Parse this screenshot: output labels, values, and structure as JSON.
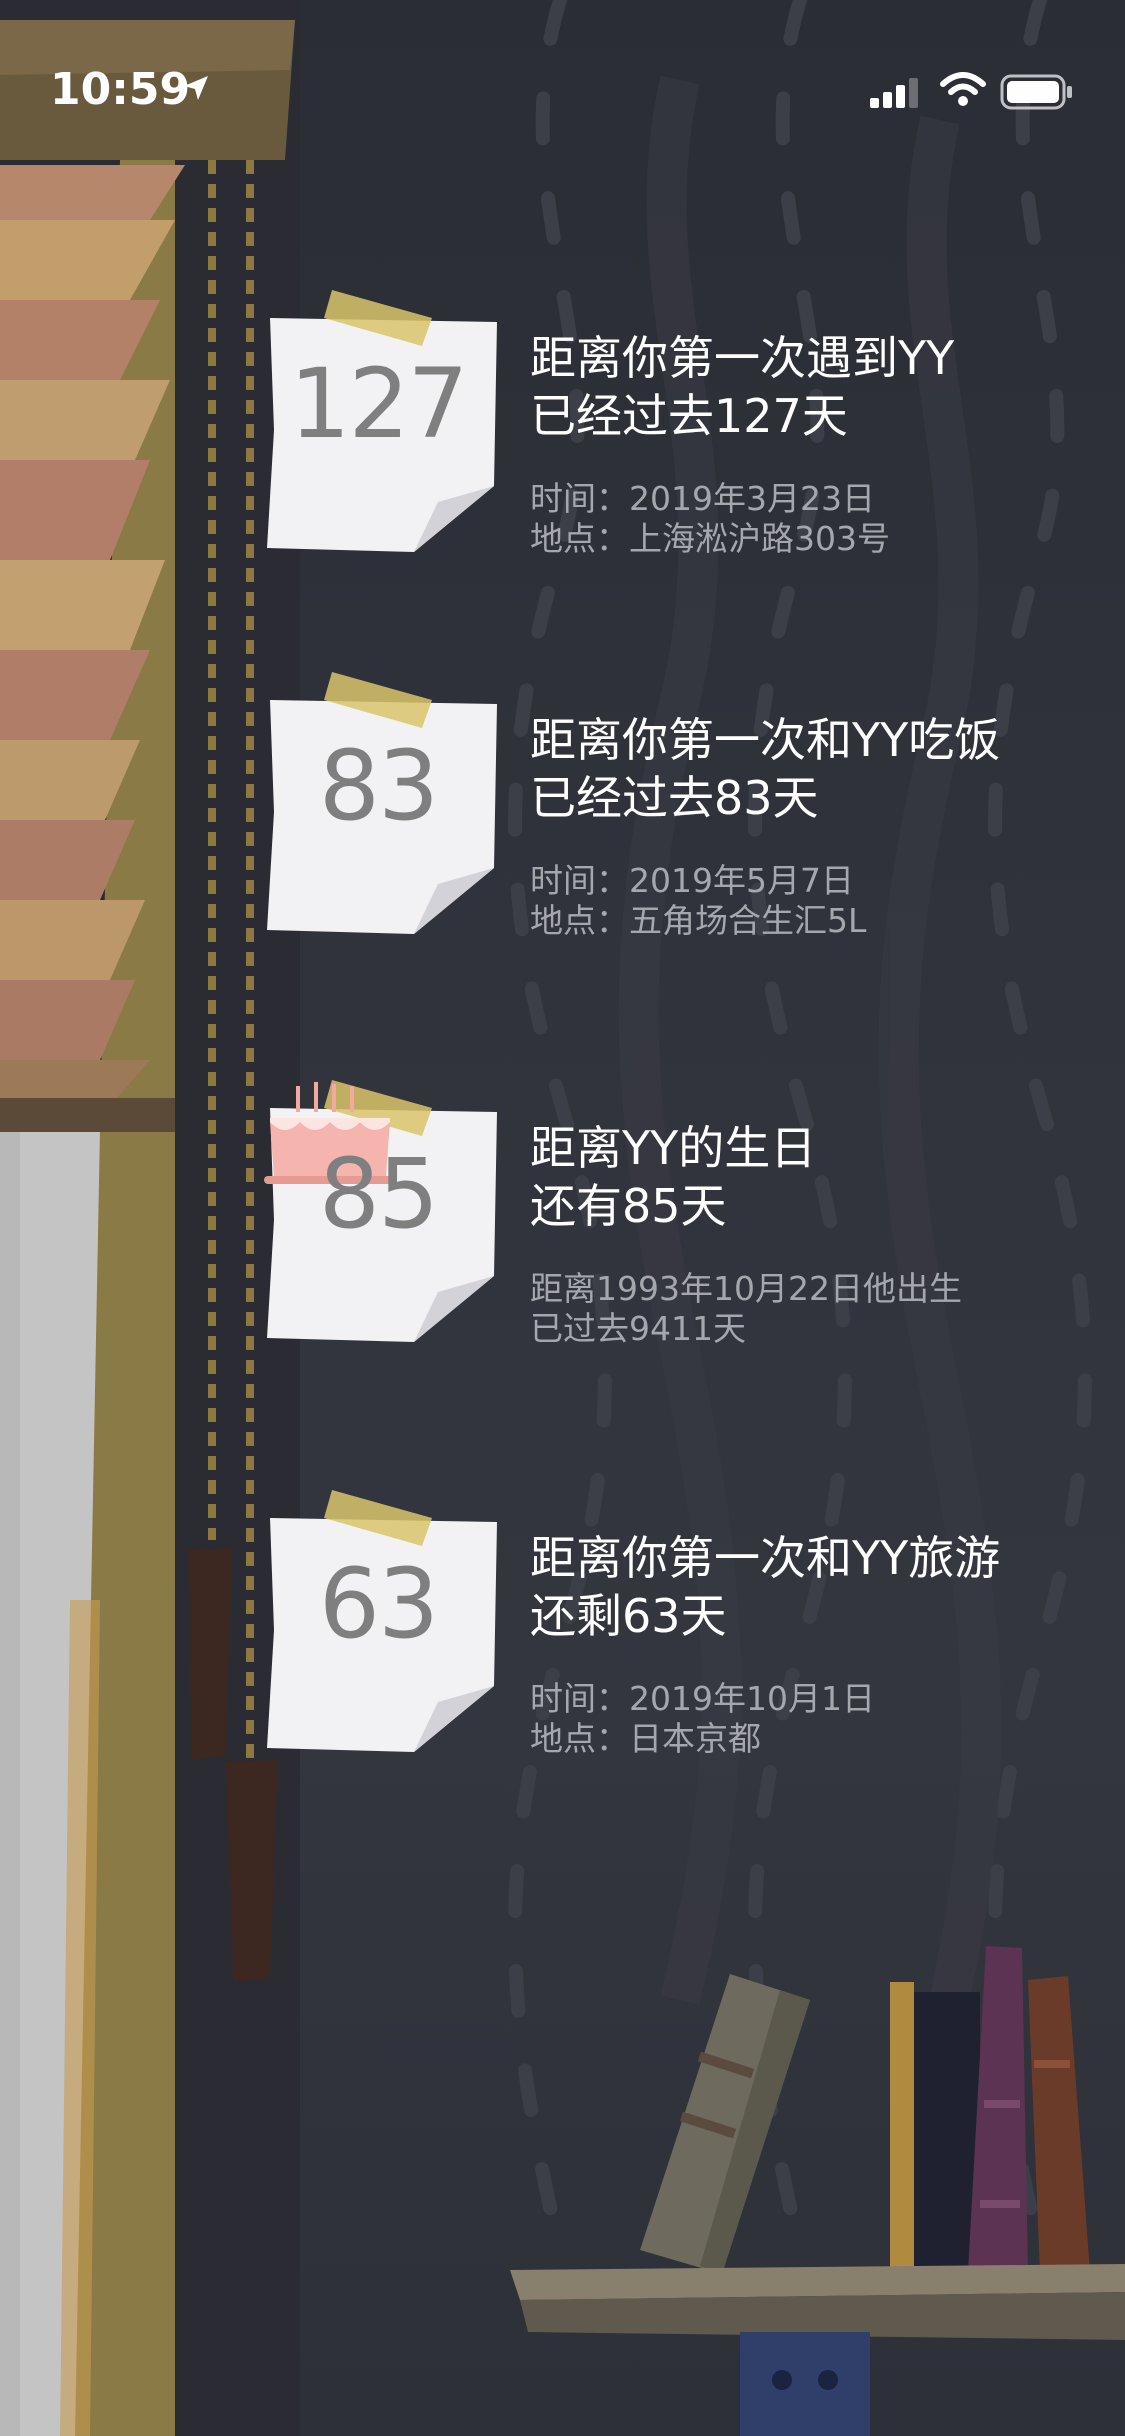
{
  "status_bar": {
    "time": "10:59",
    "icons": [
      "location-arrow-icon",
      "signal-icon",
      "wifi-icon",
      "battery-icon"
    ]
  },
  "colors": {
    "background": "#31333c",
    "note_paper": "#f2f2f4",
    "tape": "#d9c56a",
    "title_text": "#ffffff",
    "meta_text": "#a5a7ad",
    "number_text": "#7f7f80"
  },
  "events": [
    {
      "number": "127",
      "title_line1": "距离你第一次遇到YY",
      "title_line2": "已经过去127天",
      "meta_line1": "时间：2019年3月23日",
      "meta_line2": "地点：上海淞沪路303号"
    },
    {
      "number": "83",
      "title_line1": "距离你第一次和YY吃饭",
      "title_line2": "已经过去83天",
      "meta_line1": "时间：2019年5月7日",
      "meta_line2": "地点：五角场合生汇5L"
    },
    {
      "number": "85",
      "icon": "birthday-cake-icon",
      "title_line1": "距离YY的生日",
      "title_line2": "还有85天",
      "meta_line1": "距离1993年10月22日他出生",
      "meta_line2": "已过去9411天"
    },
    {
      "number": "63",
      "title_line1": "距离你第一次和YY旅游",
      "title_line2": "还剩63天",
      "meta_line1": "时间：2019年10月1日",
      "meta_line2": "地点：日本京都"
    }
  ]
}
